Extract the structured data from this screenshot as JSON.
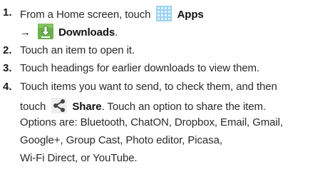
{
  "steps": [
    {
      "number": "1.",
      "line1_text": "From a Home screen, touch",
      "apps_icon": "apps-grid-icon",
      "apps_label": "Apps",
      "arrow": "→",
      "downloads_icon": "downloads-icon",
      "downloads_label": "Downloads",
      "downloads_suffix": "."
    },
    {
      "number": "2.",
      "text": "Touch an item to open it."
    },
    {
      "number": "3.",
      "text": "Touch headings for earlier downloads to view them."
    },
    {
      "number": "4.",
      "line1": "Touch items you want to send, to check them, and then",
      "line2_prefix": "touch",
      "share_icon": "share-icon",
      "share_label": "Share",
      "line2_suffix": ". Touch an option to share the item.",
      "line3": "Options are: Bluetooth, ChatON, Dropbox, Email, Gmail,",
      "line4": "Google+, Group Cast, Photo editor, Picasa,",
      "line5": "Wi-Fi Direct, or YouTube."
    }
  ],
  "colors": {
    "apps_icon": "#8fc9ef",
    "downloads_icon": "#6ab04c",
    "share_icon": "#555555"
  }
}
